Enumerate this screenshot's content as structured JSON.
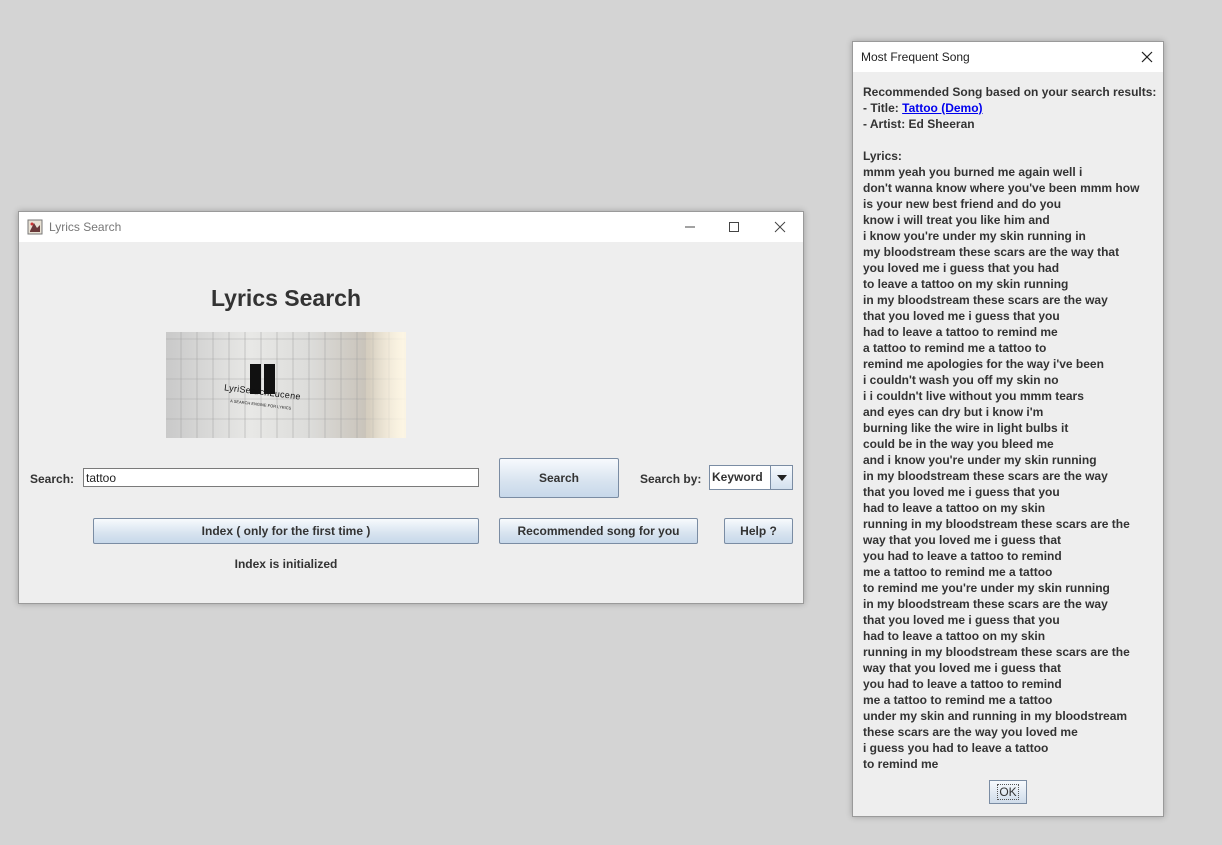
{
  "main_window": {
    "title": "Lyrics Search",
    "heading": "Lyrics Search",
    "logo": {
      "name": "LyriSearchLucene",
      "tagline": "A SEARCH ENGINE FOR LYRICS"
    },
    "search_label": "Search:",
    "search_value": "tattoo",
    "search_button": "Search",
    "search_by_label": "Search by:",
    "search_by_value": "Keyword",
    "index_button": "Index ( only for the first time )",
    "recommend_button": "Recommended song for you",
    "help_button": "Help ?",
    "status": "Index is initialized"
  },
  "dialog": {
    "title": "Most Frequent Song",
    "intro": "Recommended Song based on your search results:",
    "title_prefix": "- Title: ",
    "song_title": "Tattoo (Demo)",
    "artist_line": "- Artist: Ed Sheeran",
    "lyrics_label": "Lyrics:",
    "lyrics": [
      "mmm yeah you burned me again well i",
      "don't wanna know where you've been mmm how",
      "is your new best friend and do you",
      "know i will treat you like him and",
      "i know you're under my skin running in",
      "my bloodstream these scars are the way that",
      "you loved me i guess that you had",
      "to leave a tattoo on my skin running",
      "in my bloodstream these scars are the way",
      "that you loved me i guess that you",
      "had to leave a tattoo to remind me",
      "a tattoo to remind me a tattoo to",
      "remind me apologies for the way i've been",
      "i couldn't wash you off my skin no",
      "i i couldn't live without you mmm tears",
      "and eyes can dry but i know i'm",
      "burning like the wire in light bulbs it",
      "could be in the way you bleed me",
      "and i know you're under my skin running",
      "in my bloodstream these scars are the way",
      "that you loved me i guess that you",
      "had to leave a tattoo on my skin",
      "running in my bloodstream these scars are the",
      "way that you loved me i guess that",
      "you had to leave a tattoo to remind",
      "me a tattoo to remind me a tattoo",
      "to remind me you're under my skin running",
      "in my bloodstream these scars are the way",
      "that you loved me i guess that you",
      "had to leave a tattoo on my skin",
      "running in my bloodstream these scars are the",
      "way that you loved me i guess that",
      "you had to leave a tattoo to remind",
      "me a tattoo to remind me a tattoo",
      "under my skin and running in my bloodstream",
      "these scars are the way you loved me",
      "i guess you had to leave a tattoo",
      "to remind me"
    ],
    "ok_button": "OK"
  },
  "colors": {
    "desktop": "#d4d4d4",
    "window_bg": "#eeeeee",
    "link": "#0000ee",
    "button_gradient_top": "#f7fafd",
    "button_gradient_bottom": "#c7d8ea"
  },
  "icons": [
    "app-icon",
    "minimize-icon",
    "maximize-icon",
    "close-icon",
    "dropdown-arrow-icon"
  ]
}
